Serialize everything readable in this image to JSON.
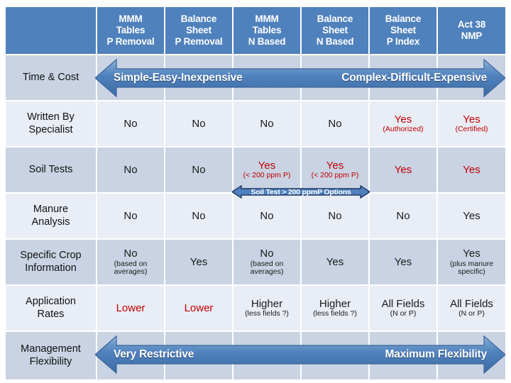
{
  "table": {
    "columns": [
      {
        "id": "criteria",
        "label": ""
      },
      {
        "id": "mmm_p",
        "label": "MMM\nTables\nP Removal",
        "lines": [
          "MMM",
          "Tables",
          "P Removal"
        ]
      },
      {
        "id": "bs_p",
        "label": "Balance\nSheet\nP Removal",
        "lines": [
          "Balance",
          "Sheet",
          "P Removal"
        ]
      },
      {
        "id": "mmm_n",
        "label": "MMM\nTables\nN Based",
        "lines": [
          "MMM",
          "Tables",
          "N Based"
        ]
      },
      {
        "id": "bs_n",
        "label": "Balance\nSheet\nN Based",
        "lines": [
          "Balance",
          "Sheet",
          "N Based"
        ]
      },
      {
        "id": "bs_pindex",
        "label": "Balance\nSheet\nP Index",
        "lines": [
          "Balance",
          "Sheet",
          "P Index"
        ]
      },
      {
        "id": "act38",
        "label": "Act 38\nNMP",
        "lines": [
          "Act 38",
          "NMP"
        ]
      }
    ],
    "rows": [
      {
        "id": "time-cost",
        "label": "Time & Cost",
        "label_lines": [
          "Time & Cost"
        ],
        "type": "arrow",
        "arrow": {
          "left_label": "Simple-Easy-Inexpensive",
          "right_label": "Complex-Difficult-Expensive"
        },
        "cells": []
      },
      {
        "id": "written-by-specialist",
        "label": "Written By Specialist",
        "label_lines": [
          "Written By",
          "Specialist"
        ],
        "type": "data",
        "cells": [
          {
            "main": "No",
            "sub": "",
            "color": "black"
          },
          {
            "main": "No",
            "sub": "",
            "color": "black"
          },
          {
            "main": "No",
            "sub": "",
            "color": "black"
          },
          {
            "main": "No",
            "sub": "",
            "color": "black"
          },
          {
            "main": "Yes",
            "sub": "(Authorized)",
            "color": "red"
          },
          {
            "main": "Yes",
            "sub": "(Certified)",
            "color": "red"
          }
        ]
      },
      {
        "id": "soil-tests",
        "label": "Soil Tests",
        "label_lines": [
          "Soil Tests"
        ],
        "type": "data",
        "cells": [
          {
            "main": "No",
            "sub": "",
            "color": "black"
          },
          {
            "main": "No",
            "sub": "",
            "color": "black"
          },
          {
            "main": "Yes",
            "sub": "(< 200 ppm P)",
            "color": "red"
          },
          {
            "main": "Yes",
            "sub": "(< 200 ppm P)",
            "color": "red"
          },
          {
            "main": "Yes",
            "sub": "",
            "color": "red"
          },
          {
            "main": "Yes",
            "sub": "",
            "color": "red"
          }
        ]
      },
      {
        "id": "manure-analysis",
        "label": "Manure Analysis",
        "label_lines": [
          "Manure",
          "Analysis"
        ],
        "type": "data",
        "cells": [
          {
            "main": "No",
            "sub": "",
            "color": "black"
          },
          {
            "main": "No",
            "sub": "",
            "color": "black"
          },
          {
            "main": "No",
            "sub": "",
            "color": "black"
          },
          {
            "main": "No",
            "sub": "",
            "color": "black"
          },
          {
            "main": "No",
            "sub": "",
            "color": "black"
          },
          {
            "main": "Yes",
            "sub": "",
            "color": "black"
          }
        ]
      },
      {
        "id": "specific-crop-information",
        "label": "Specific Crop Information",
        "label_lines": [
          "Specific Crop",
          "Information"
        ],
        "type": "data",
        "cells": [
          {
            "main": "No",
            "sub": "(based on averages)",
            "color": "black"
          },
          {
            "main": "Yes",
            "sub": "",
            "color": "black"
          },
          {
            "main": "No",
            "sub": "(based on averages)",
            "color": "black"
          },
          {
            "main": "Yes",
            "sub": "",
            "color": "black"
          },
          {
            "main": "Yes",
            "sub": "",
            "color": "black"
          },
          {
            "main": "Yes",
            "sub": "(plus manure specific)",
            "color": "black"
          }
        ]
      },
      {
        "id": "application-rates",
        "label": "Application Rates",
        "label_lines": [
          "Application",
          "Rates"
        ],
        "type": "data",
        "cells": [
          {
            "main": "Lower",
            "sub": "",
            "color": "red"
          },
          {
            "main": "Lower",
            "sub": "",
            "color": "red"
          },
          {
            "main": "Higher",
            "sub": "(less fields ?)",
            "color": "black"
          },
          {
            "main": "Higher",
            "sub": "(less fields ?)",
            "color": "black"
          },
          {
            "main": "All Fields",
            "sub": "(N or P)",
            "color": "black"
          },
          {
            "main": "All Fields",
            "sub": "(N or P)",
            "color": "black"
          }
        ]
      },
      {
        "id": "management-flexibility",
        "label": "Management Flexibility",
        "label_lines": [
          "Management",
          "Flexibility"
        ],
        "type": "arrow",
        "arrow": {
          "left_label": "Very Restrictive",
          "right_label": "Maximum Flexibility"
        },
        "cells": []
      }
    ]
  },
  "banner": {
    "id": "soil-test-options-banner",
    "label": "Soil Test > 200 ppmP  Options"
  },
  "colors": {
    "header_blue": "#4f81bd",
    "band_dark": "#c9d3e3",
    "band_light": "#e9edf5",
    "arrow_blue": "#4f81bd",
    "red_text": "#c00000",
    "black_text": "#1a1a1a",
    "banner_border": "#1f3864"
  }
}
